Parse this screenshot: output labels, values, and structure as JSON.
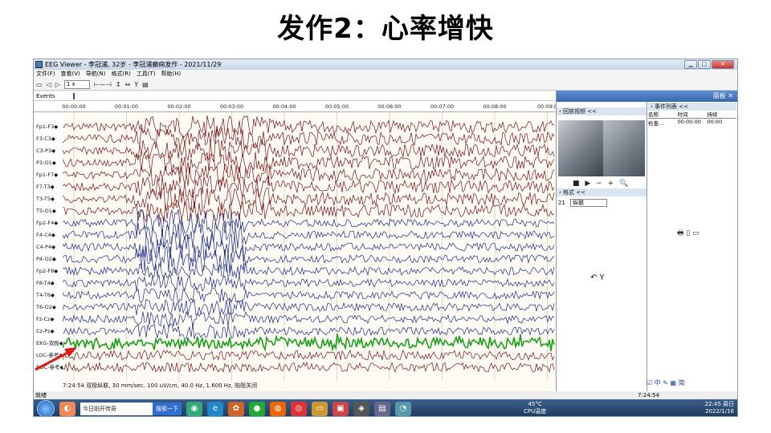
{
  "slide_title": "发作2：心率增快",
  "window": {
    "title": "EEG Viewer - 李冠浦, 32岁 - 李冠浦癫痫发作 - 2021/11/29",
    "buttons": {
      "minimize": "▁",
      "maximize": "□",
      "close": "✕"
    }
  },
  "menu": [
    "文件(F)",
    "查看(V)",
    "导航(N)",
    "格式(R)",
    "工具(T)",
    "帮助(H)"
  ],
  "toolbar": {
    "zoom_value": "1 x"
  },
  "events_label": "Events",
  "time_ticks": [
    "00:00:00",
    "00:01:00",
    "00:02:00",
    "00:03:00",
    "00:04:00",
    "00:05:00",
    "00:06:00",
    "00:07:00",
    "00:08:00",
    "00:09:0"
  ],
  "channels": [
    "Fp1-F3",
    "F3-C3",
    "C3-P3",
    "P3-O1",
    "Fp1-F7",
    "F7-T3",
    "T3-T5",
    "T5-O1",
    "Fp2-F4",
    "F4-C4",
    "C4-P4",
    "P4-O2",
    "Fp2-F8",
    "F8-T4",
    "T4-T6",
    "T6-O2",
    "Fz-Cz",
    "Cz-Pz",
    "EKG-双极",
    "LOC-参考",
    "ROC-参考"
  ],
  "status_line": "7:24:54 双极纵联, 30 mm/sec, 100 uV/cm, 40.0 Hz, 1.600 Hz, 陷阻关闭",
  "panel": {
    "header": "面板",
    "video_label": "回放视频 <<",
    "video_controls": "■ ▶ − + 🔍",
    "format_label": "格式 <<",
    "format_number": "21",
    "format_value": "纵联",
    "event_list_label": "事件列表 <<",
    "event_table": {
      "headers": [
        "名称",
        "时间",
        "持续"
      ],
      "rows": [
        [
          "检查...",
          "00:00:00",
          "00:00"
        ]
      ]
    },
    "bottom_icons": "☑ 中 ✎ ▦ 简"
  },
  "statusbar": {
    "left": "就绪",
    "right": "7:24:54"
  },
  "taskbar": {
    "search_text": "今日刚开传奇",
    "search_button": "搜索一下",
    "temp": "45°C",
    "temp_label": "CPU温度",
    "time": "22:45 周日",
    "date": "2022/1/16"
  },
  "colors": {
    "frontal": "#7a1010",
    "central": "#1a2a8a",
    "ekg": "#1aa01a",
    "loc": "#7a1010"
  }
}
